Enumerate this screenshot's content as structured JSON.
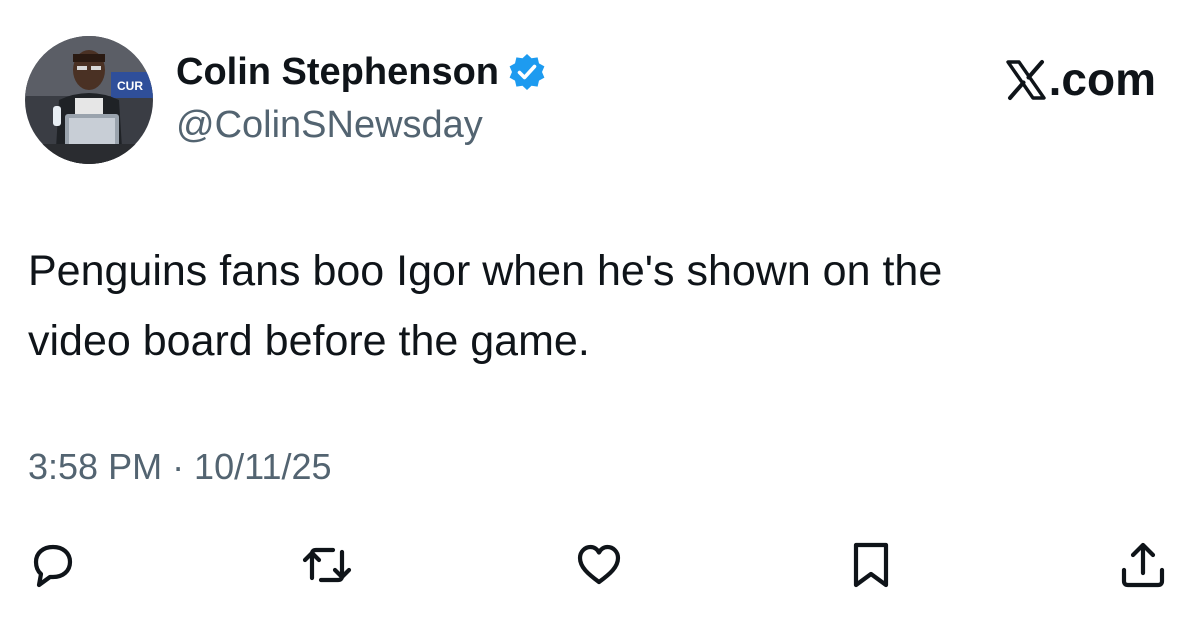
{
  "tweet": {
    "author": {
      "display_name": "Colin Stephenson",
      "handle": "@ColinSNewsday",
      "verified": true,
      "verified_color": "#1d9bf0"
    },
    "brand": ".com",
    "text": "Penguins fans boo Igor when he's shown on the\nvideo board before the game.",
    "timestamp": "3:58 PM · 10/11/25"
  },
  "actions": [
    {
      "name": "reply",
      "icon": "speech-bubble-icon"
    },
    {
      "name": "repost",
      "icon": "repost-arrows-icon"
    },
    {
      "name": "like",
      "icon": "heart-icon"
    },
    {
      "name": "bookmark",
      "icon": "bookmark-icon"
    },
    {
      "name": "share",
      "icon": "share-upload-icon"
    }
  ],
  "colors": {
    "text_primary": "#0f1419",
    "text_secondary": "#536471"
  }
}
